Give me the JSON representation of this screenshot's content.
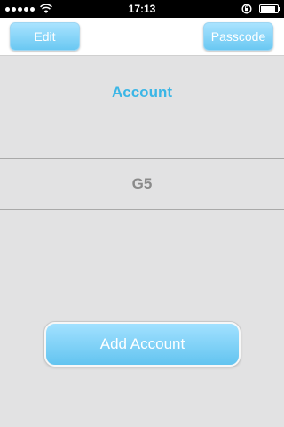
{
  "status_bar": {
    "time": "17:13",
    "signal_icon": "signal-dots-icon",
    "wifi_icon": "wifi-icon",
    "rotation_lock_icon": "rotation-lock-icon",
    "battery_icon": "battery-icon",
    "battery_level": 0.9
  },
  "nav": {
    "edit_label": "Edit",
    "passcode_label": "Passcode"
  },
  "main": {
    "section_title": "Account",
    "accounts": [
      "G5"
    ],
    "add_account_label": "Add Account"
  },
  "colors": {
    "accent": "#3bb6e6",
    "button_top": "#a9e3ff",
    "button_bottom": "#6ac8f2",
    "background": "#e2e2e3"
  }
}
